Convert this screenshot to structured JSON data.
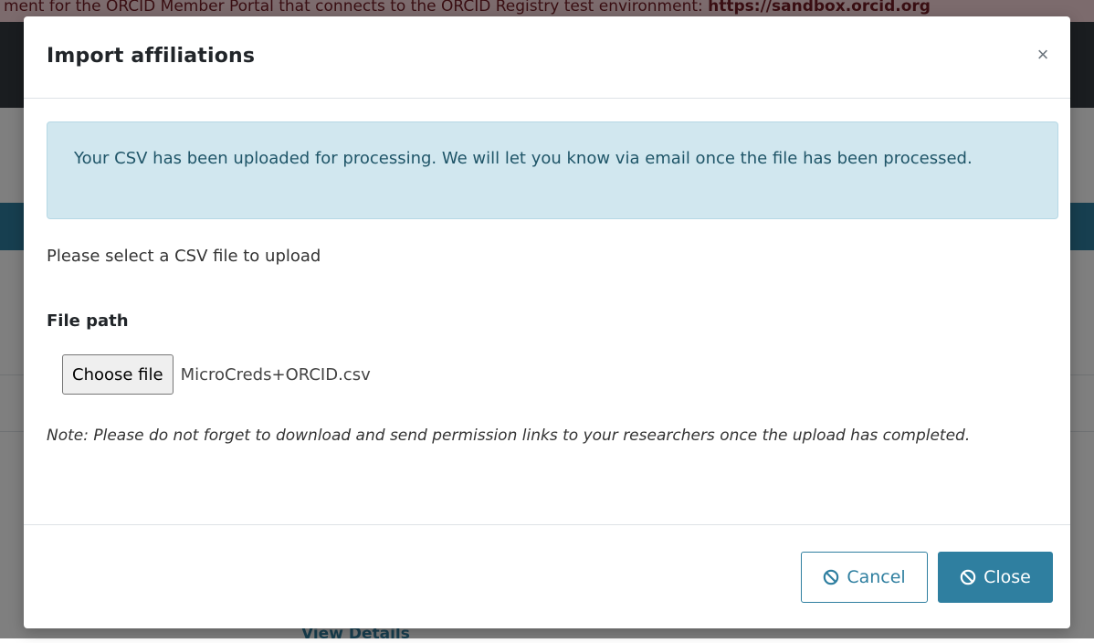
{
  "background": {
    "banner_text": "ment for the ORCID Member Portal that connects to the ORCID Registry test environment:",
    "banner_link": "https://sandbox.orcid.org",
    "link_text": "View Details"
  },
  "modal": {
    "title": "Import affiliations",
    "close_symbol": "×",
    "alert": "Your CSV has been uploaded for processing. We will let you know via email once the file has been processed.",
    "prompt": "Please select a CSV file to upload",
    "field_label": "File path",
    "file_button": "Choose file",
    "file_name": "MicroCreds+ORCID.csv",
    "note": "Note: Please do not forget to download and send permission links to your researchers once the upload has completed.",
    "cancel_label": "Cancel",
    "close_label": "Close",
    "colors": {
      "primary": "#2f7fa0",
      "alert_bg": "#d1e7ef",
      "alert_text": "#1f5568"
    }
  }
}
